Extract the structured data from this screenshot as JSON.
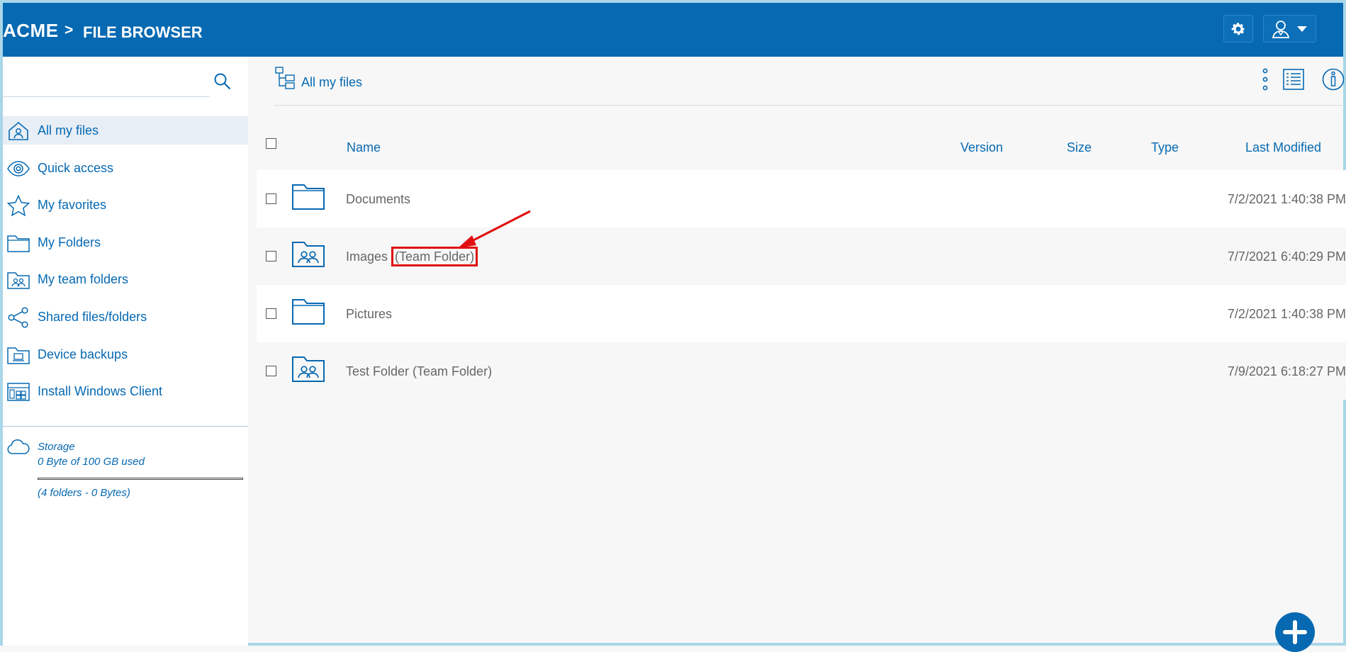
{
  "header": {
    "brand": "ACME",
    "separator": ">",
    "title": "FILE BROWSER",
    "settings_icon": "gear-icon",
    "user_icon": "user-icon"
  },
  "sidebar": {
    "search_placeholder": "",
    "items": [
      {
        "label": "All my files",
        "icon": "home-icon"
      },
      {
        "label": "Quick access",
        "icon": "eye-icon"
      },
      {
        "label": "My favorites",
        "icon": "star-icon"
      },
      {
        "label": "My Folders",
        "icon": "folder-icon"
      },
      {
        "label": "My team folders",
        "icon": "team-folder-icon"
      },
      {
        "label": "Shared files/folders",
        "icon": "share-icon"
      },
      {
        "label": "Device backups",
        "icon": "backup-icon"
      },
      {
        "label": "Install Windows Client",
        "icon": "windows-client-icon"
      }
    ],
    "storage": {
      "title": "Storage",
      "used": "0 Byte of 100 GB used",
      "used_fraction": 0,
      "count": "(4 folders - 0 Bytes)"
    }
  },
  "main": {
    "path_label": "All my files",
    "columns": {
      "name": "Name",
      "version": "Version",
      "size": "Size",
      "type": "Type",
      "modified": "Last Modified"
    },
    "rows": [
      {
        "name": "Documents",
        "suffix": "",
        "modified": "7/2/2021 1:40:38 PM",
        "icon": "folder-icon"
      },
      {
        "name": "Images",
        "suffix": "(Team Folder)",
        "modified": "7/7/2021 6:40:29 PM",
        "icon": "team-folder-icon"
      },
      {
        "name": "Pictures",
        "suffix": "",
        "modified": "7/2/2021 1:40:38 PM",
        "icon": "folder-icon"
      },
      {
        "name": "Test Folder (Team Folder)",
        "suffix": "",
        "modified": "7/9/2021 6:18:27 PM",
        "icon": "team-folder-icon"
      }
    ]
  },
  "colors": {
    "header_bg": "#0669b2",
    "accent": "#0669b2",
    "annotation": "#e01010"
  }
}
